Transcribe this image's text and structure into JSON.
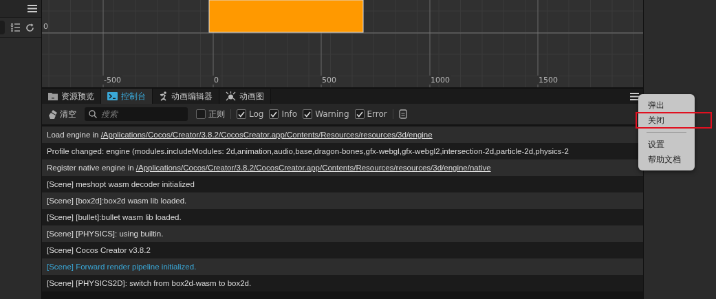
{
  "scene": {
    "y_label": "0",
    "x_labels": [
      "-500",
      "0",
      "500",
      "1000",
      "1500"
    ]
  },
  "console": {
    "tabs": [
      {
        "label": "资源预览",
        "selected": false
      },
      {
        "label": "控制台",
        "selected": true
      },
      {
        "label": "动画编辑器",
        "selected": false
      },
      {
        "label": "动画图",
        "selected": false
      }
    ],
    "clear_label": "清空",
    "search": {
      "placeholder": "搜索"
    },
    "filters": [
      {
        "label": "正则",
        "checked": false
      },
      {
        "label": "Log",
        "checked": true
      },
      {
        "label": "Info",
        "checked": true
      },
      {
        "label": "Warning",
        "checked": true
      },
      {
        "label": "Error",
        "checked": true
      }
    ],
    "logs": [
      {
        "kind": "log",
        "text": "Load engine in ",
        "link": "/Applications/Cocos/Creator/3.8.2/CocosCreator.app/Contents/Resources/resources/3d/engine"
      },
      {
        "kind": "log",
        "text": "Profile changed: engine (modules.includeModules: 2d,animation,audio,base,dragon-bones,gfx-webgl,gfx-webgl2,intersection-2d,particle-2d,physics-2"
      },
      {
        "kind": "log",
        "text": "Register native engine in ",
        "link": "/Applications/Cocos/Creator/3.8.2/CocosCreator.app/Contents/Resources/resources/3d/engine/native"
      },
      {
        "kind": "log",
        "text": "[Scene] meshopt wasm decoder initialized"
      },
      {
        "kind": "log",
        "text": "[Scene] [box2d]:box2d wasm lib loaded."
      },
      {
        "kind": "log",
        "text": "[Scene] [bullet]:bullet wasm lib loaded."
      },
      {
        "kind": "log",
        "text": "[Scene] [PHYSICS]: using builtin."
      },
      {
        "kind": "log",
        "text": "[Scene] Cocos Creator v3.8.2"
      },
      {
        "kind": "info",
        "text": "[Scene] Forward render pipeline initialized."
      },
      {
        "kind": "log",
        "text": "[Scene] [PHYSICS2D]: switch from box2d-wasm to box2d."
      }
    ]
  },
  "menu": {
    "items": [
      {
        "kind": "item",
        "label": "弹出",
        "highlighted": false
      },
      {
        "kind": "item",
        "label": "关闭",
        "highlighted": true
      },
      {
        "kind": "separator"
      },
      {
        "kind": "item",
        "label": "设置",
        "highlighted": false
      },
      {
        "kind": "item",
        "label": "帮助文档",
        "highlighted": false
      }
    ]
  }
}
